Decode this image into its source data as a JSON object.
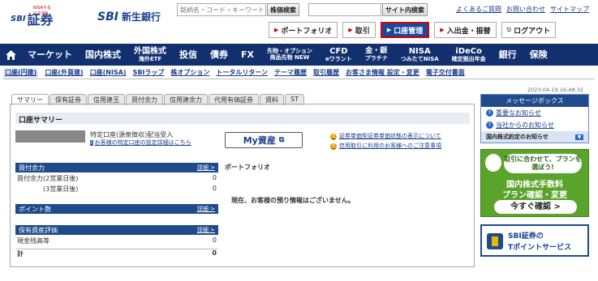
{
  "header": {
    "sbi_securities_tagline": "NISAやるならSBI",
    "sbi_securities_logo_mark": "SBI",
    "sbi_securities_logo_text": "証券",
    "sbi_bank_logo_mark": "SBI",
    "sbi_bank_logo_text": "新生銀行",
    "stock_search_placeholder": "銘柄名・コード・キーワード",
    "stock_search_button": "株価検索",
    "site_search_button": "サイト内検索",
    "links": [
      "よくあるご質問",
      "お問い合わせ",
      "サイトマップ"
    ]
  },
  "actions": [
    {
      "label": "ポートフォリオ",
      "active": false
    },
    {
      "label": "取引",
      "active": false
    },
    {
      "label": "口座管理",
      "active": true
    },
    {
      "label": "入出金・振替",
      "active": false
    },
    {
      "label": "ログアウト",
      "active": false
    }
  ],
  "nav": {
    "items": [
      {
        "label": "マーケット",
        "sub": ""
      },
      {
        "label": "国内株式",
        "sub": ""
      },
      {
        "label": "外国株式",
        "sub": "海外ETF"
      },
      {
        "label": "投信",
        "sub": ""
      },
      {
        "label": "債券",
        "sub": ""
      },
      {
        "label": "FX",
        "sub": ""
      },
      {
        "label": "先物・オプション",
        "sub": "商品先物 NEW"
      },
      {
        "label": "CFD",
        "sub": "eワラント"
      },
      {
        "label": "金・銀",
        "sub": "プラチナ"
      },
      {
        "label": "NISA",
        "sub": "つみたてNISA"
      },
      {
        "label": "iDeCo",
        "sub": "確定拠出年金"
      },
      {
        "label": "銀行",
        "sub": ""
      },
      {
        "label": "保険",
        "sub": ""
      }
    ]
  },
  "subnav": [
    "口座(円建)",
    "口座(外貨建)",
    "口座(NISA)",
    "SBIラップ",
    "株オプション",
    "トータルリターン",
    "テーマ履歴",
    "取引履歴",
    "お客さま情報 設定・変更",
    "電子交付書面"
  ],
  "timestamp": "2023-04-19 16:48:32",
  "tabs": [
    "サマリー",
    "保有証券",
    "信用建玉",
    "買付余力",
    "信用建余力",
    "代用有価証券",
    "資料",
    "ST"
  ],
  "summary": {
    "title": "口座サマリー",
    "account_type": "特定口座(源泉徴収)配当受入",
    "account_sub": "お客様の特定口座の設定詳細はこちら",
    "myasset_label": "My資産",
    "notices": [
      "証券単価型証券単価状態の表示について",
      "信用取引に利用のお客様へのご注意事項"
    ]
  },
  "sections": {
    "buying_power": {
      "title": "買付余力",
      "detail": "詳細 >",
      "rows": [
        {
          "label": "買付余力(2営業日後)",
          "value": "0"
        },
        {
          "label": "(3営業日後)",
          "value": "0"
        }
      ]
    },
    "points": {
      "title": "ポイント数",
      "detail": "詳細 >"
    },
    "holdings": {
      "title": "保有資産評価",
      "detail": "詳細 >",
      "rows": [
        {
          "label": "現金残高等",
          "value": "0"
        },
        {
          "label": "計",
          "value": "0"
        }
      ]
    }
  },
  "portfolio": {
    "title": "ポートフォリオ",
    "message": "現在、お客様の預り情報はございません。"
  },
  "sidebar": {
    "message_box_title": "メッセージボックス",
    "messages": [
      "重要なお知らせ",
      "当社からのお知らせ"
    ],
    "footer": "国内株式約定のお知らせ",
    "promo_bubble": "取引に合わせて、プランを選ぼう!",
    "promo_line1": "国内株式手数料",
    "promo_line2": "プラン確認・変更",
    "promo_button": "今すぐ確認 >",
    "tpoint_line1": "SBI証券の",
    "tpoint_line2": "Tポイントサービス"
  }
}
